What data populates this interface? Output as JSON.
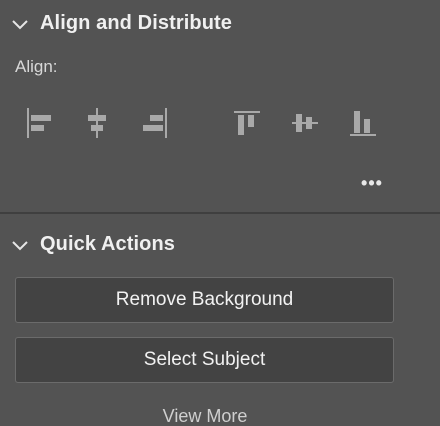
{
  "align_distribute": {
    "title": "Align and Distribute",
    "align_label": "Align:",
    "icons": [
      {
        "name": "align-left-icon"
      },
      {
        "name": "align-horizontal-center-icon"
      },
      {
        "name": "align-right-icon"
      },
      {
        "name": "align-top-icon"
      },
      {
        "name": "align-vertical-center-icon"
      },
      {
        "name": "align-bottom-icon"
      }
    ],
    "more_label": "•••"
  },
  "quick_actions": {
    "title": "Quick Actions",
    "buttons": [
      {
        "label": "Remove Background"
      },
      {
        "label": "Select Subject"
      }
    ],
    "view_more": "View More"
  },
  "colors": {
    "panel_bg": "#535353",
    "button_bg": "#434343",
    "button_border": "#6b6b6b",
    "icon": "#a9a9a9",
    "text": "#f0f0f0"
  }
}
